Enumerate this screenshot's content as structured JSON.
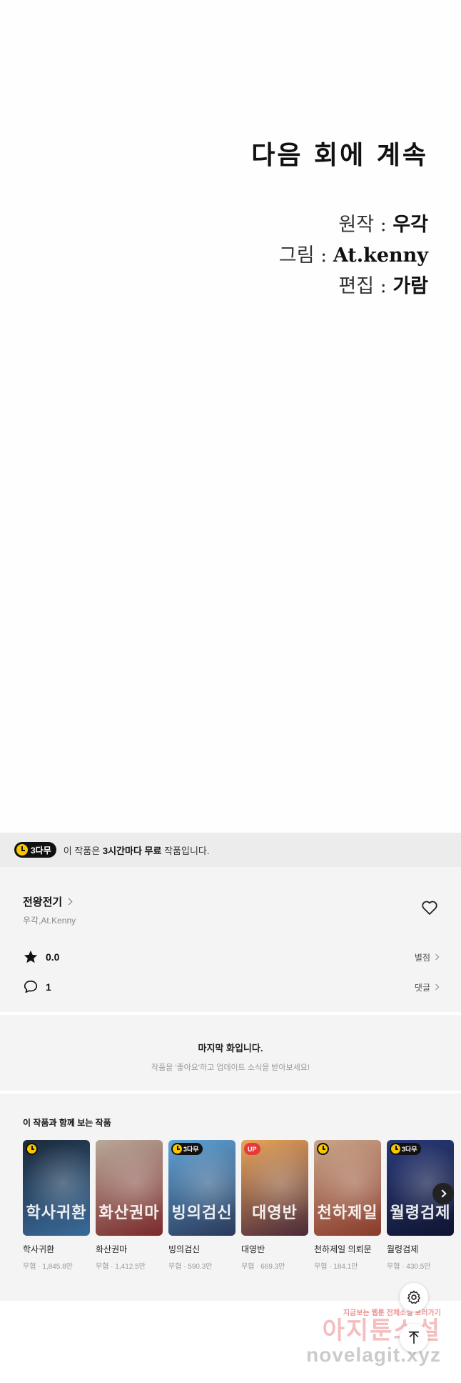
{
  "artwork": {
    "continue_text": "다음 회에 계속",
    "credits": [
      {
        "role": "원작 : ",
        "name": "우각"
      },
      {
        "role": "그림 : ",
        "name": "At.kenny"
      },
      {
        "role": "편집 : ",
        "name": "가람"
      }
    ]
  },
  "free_banner": {
    "badge": "3다무",
    "text_prefix": "이 작품은 ",
    "text_bold": "3시간마다 무료",
    "text_suffix": " 작품입니다."
  },
  "series": {
    "title": "전왕전기",
    "authors": "우각,At.Kenny",
    "rating": "0.0",
    "rating_link": "별점",
    "comments": "1",
    "comments_link": "댓글"
  },
  "last_episode": {
    "title": "마지막 화입니다.",
    "subtitle": "작품을 '좋아요'하고 업데이트 소식을 받아보세요!"
  },
  "recommendations": {
    "title": "이 작품과 함께 보는 작품",
    "items": [
      {
        "name": "학사귀환",
        "meta": "무협 · 1,845.8만",
        "badge": "clock",
        "art": "학사귀환",
        "colors": [
          "#1b2a3a",
          "#3a6a9a"
        ]
      },
      {
        "name": "화산권마",
        "meta": "무협 · 1,412.5만",
        "badge": "",
        "art": "화산권마",
        "colors": [
          "#b9a99a",
          "#7a2a2a"
        ]
      },
      {
        "name": "빙의검신",
        "meta": "무협 · 590.3만",
        "badge": "3다무",
        "art": "빙의검신",
        "colors": [
          "#5fa3d6",
          "#2a3a5a"
        ]
      },
      {
        "name": "대영반",
        "meta": "무협 · 669.3만",
        "badge": "UP",
        "art": "대영반",
        "colors": [
          "#e8a55a",
          "#4a2a3a"
        ]
      },
      {
        "name": "천하제일 의뢰문",
        "meta": "무협 · 184.1만",
        "badge": "clock",
        "art": "천하제일",
        "colors": [
          "#c9a78a",
          "#8a3a2a"
        ]
      },
      {
        "name": "월령검제",
        "meta": "무협 · 430.5만",
        "badge": "3다무",
        "art": "월령검제",
        "colors": [
          "#2a3a7a",
          "#0f1530"
        ]
      }
    ]
  },
  "watermark": {
    "small": "지금보는 웹툰 전체소설 보러가기",
    "big": "아지툰소설",
    "url": "novelagit.xyz"
  },
  "icons": {
    "heart": "heart-icon",
    "star": "star-icon",
    "comment": "comment-bubble-icon",
    "next": "chevron-right-icon",
    "gear": "gear-icon",
    "scroll_top": "arrow-up-icon"
  },
  "colors": {
    "badge_yellow": "#f7c600",
    "up_red": "#e43a3a"
  }
}
